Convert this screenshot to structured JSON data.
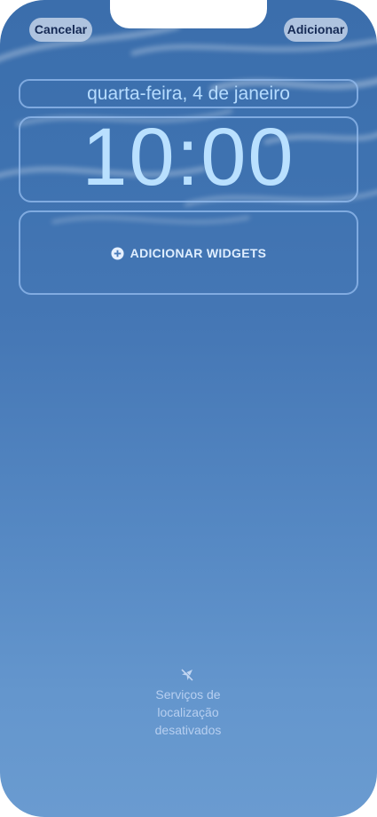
{
  "header": {
    "cancel_label": "Cancelar",
    "add_label": "Adicionar"
  },
  "lockscreen": {
    "date": "quarta-feira, 4 de janeiro",
    "time": "10:00",
    "add_widgets_label": "ADICIONAR WIDGETS"
  },
  "location_status": {
    "icon": "location-off-icon",
    "line1": "Serviços de",
    "line2": "localização",
    "line3": "desativados"
  },
  "colors": {
    "wallpaper_top": "#3b6eac",
    "wallpaper_bottom": "#6a9bd0",
    "button_bg": "#c3d2e8",
    "button_text": "#152a55",
    "outline": "#96bef0",
    "clock_text": "#b9e0ff"
  }
}
